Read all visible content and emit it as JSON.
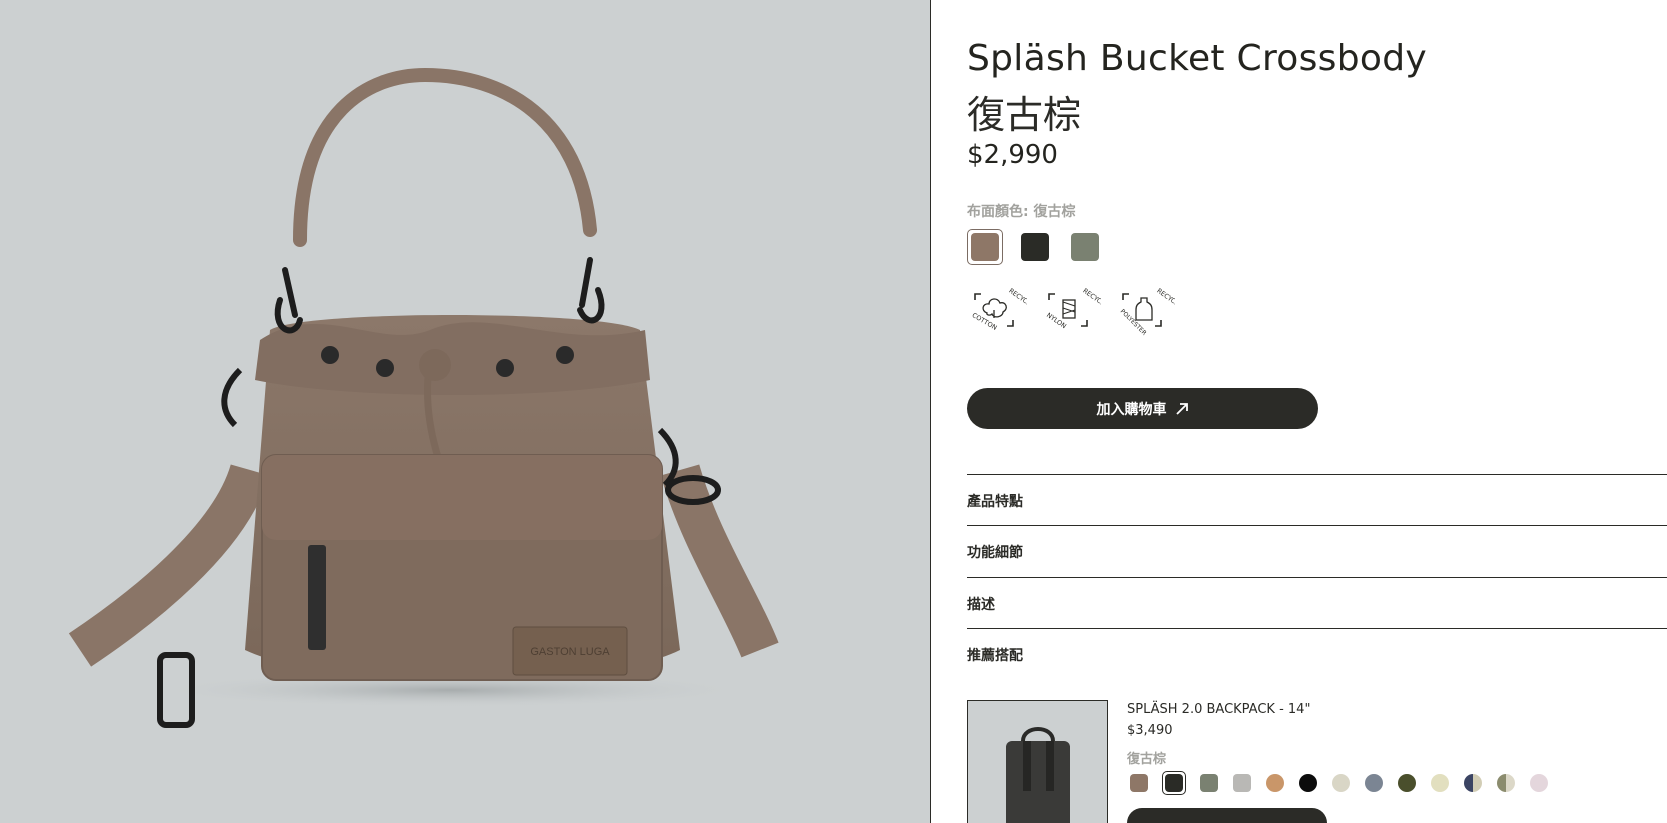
{
  "product": {
    "title": "Spläsh Bucket Crossbody",
    "color_name": "復古棕",
    "price": "$2,990",
    "color_label": "布面顏色: 復古棕",
    "swatches": [
      {
        "name": "復古棕",
        "hex": "#8e7767",
        "selected": true
      },
      {
        "name": "black",
        "hex": "#2a2b26",
        "selected": false
      },
      {
        "name": "green",
        "hex": "#7a8171",
        "selected": false
      }
    ],
    "badges": [
      {
        "top": "RECYCLED",
        "bottom": "COTTON",
        "icon": "cotton-icon"
      },
      {
        "top": "RECYCLED",
        "bottom": "NYLON",
        "icon": "nylon-icon"
      },
      {
        "top": "RECYCLED",
        "bottom": "POLYESTER",
        "icon": "bottle-icon"
      }
    ],
    "brand_patch": "GASTON LUGA"
  },
  "cart": {
    "label": "加入購物車",
    "icon": "arrow-up-right-icon"
  },
  "accordion": [
    {
      "label": "產品特點"
    },
    {
      "label": "功能細節"
    },
    {
      "label": "描述"
    },
    {
      "label": "推薦搭配"
    }
  ],
  "recommended": {
    "name": "SPLÄSH 2.0 BACKPACK - 14\"",
    "price": "$3,490",
    "color": "復古棕",
    "swatches": [
      "#8e7767",
      "#2a2b26",
      "#7a8171",
      "#b9b8b5",
      "#c99669",
      "#0c0c0c",
      "#d9d6c6",
      "#7b8593",
      "#4a4f2c",
      "#e2dfbf",
      "#3b4463|#d2cdb5",
      "#8b8c6e|#dcd8c8",
      "#e4d6dc"
    ]
  },
  "colors": {
    "ink": "#2b2b27",
    "muted": "#a2a29e",
    "bg_media": "#ccd0d1"
  }
}
